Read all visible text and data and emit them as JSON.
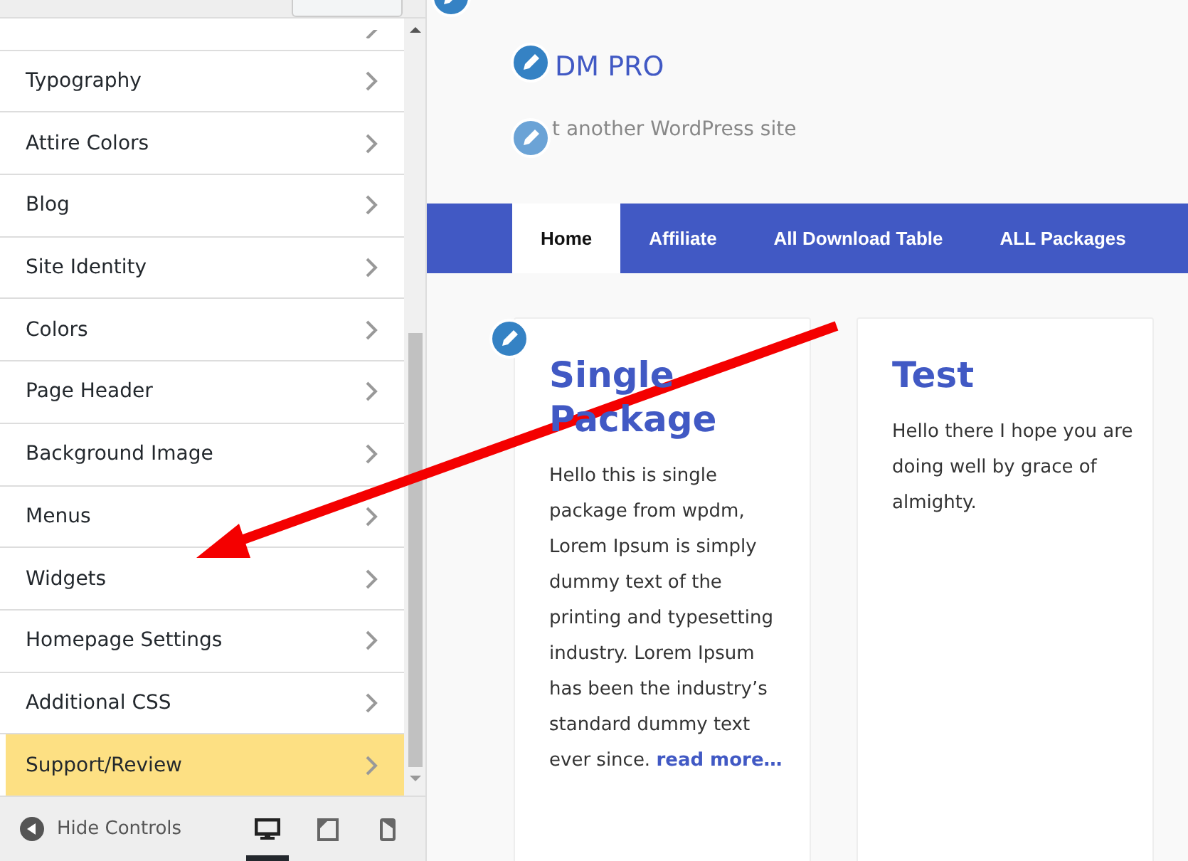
{
  "sidebar": {
    "items": [
      {
        "label": "Typography",
        "highlighted": false
      },
      {
        "label": "Attire Colors",
        "highlighted": false
      },
      {
        "label": "Blog",
        "highlighted": false
      },
      {
        "label": "Site Identity",
        "highlighted": false
      },
      {
        "label": "Colors",
        "highlighted": false
      },
      {
        "label": "Page Header",
        "highlighted": false
      },
      {
        "label": "Background Image",
        "highlighted": false
      },
      {
        "label": "Menus",
        "highlighted": false
      },
      {
        "label": "Widgets",
        "highlighted": false
      },
      {
        "label": "Homepage Settings",
        "highlighted": false
      },
      {
        "label": "Additional CSS",
        "highlighted": false
      },
      {
        "label": "Support/Review",
        "highlighted": true
      }
    ]
  },
  "footer": {
    "hide_controls": "Hide Controls",
    "devices": [
      {
        "kind": "desktop",
        "selected": true
      },
      {
        "kind": "tablet",
        "selected": false
      },
      {
        "kind": "mobile",
        "selected": false
      }
    ]
  },
  "preview": {
    "site_title": "DM PRO",
    "tagline": "t another WordPress site",
    "nav": [
      {
        "label": "Home",
        "selected": true
      },
      {
        "label": "Affiliate",
        "selected": false
      },
      {
        "label": "All Download Table",
        "selected": false
      },
      {
        "label": "ALL Packages",
        "selected": false
      }
    ],
    "posts": [
      {
        "title": "Single Package",
        "excerpt": "Hello this is single package from wpdm, Lorem Ipsum is simply dummy text of the printing and typesetting industry. Lorem Ipsum has been the industry’s standard dummy text ever since.",
        "link": "read more…"
      },
      {
        "title": "Test",
        "excerpt": "Hello there I hope you are doing well by grace of almighty."
      }
    ]
  }
}
